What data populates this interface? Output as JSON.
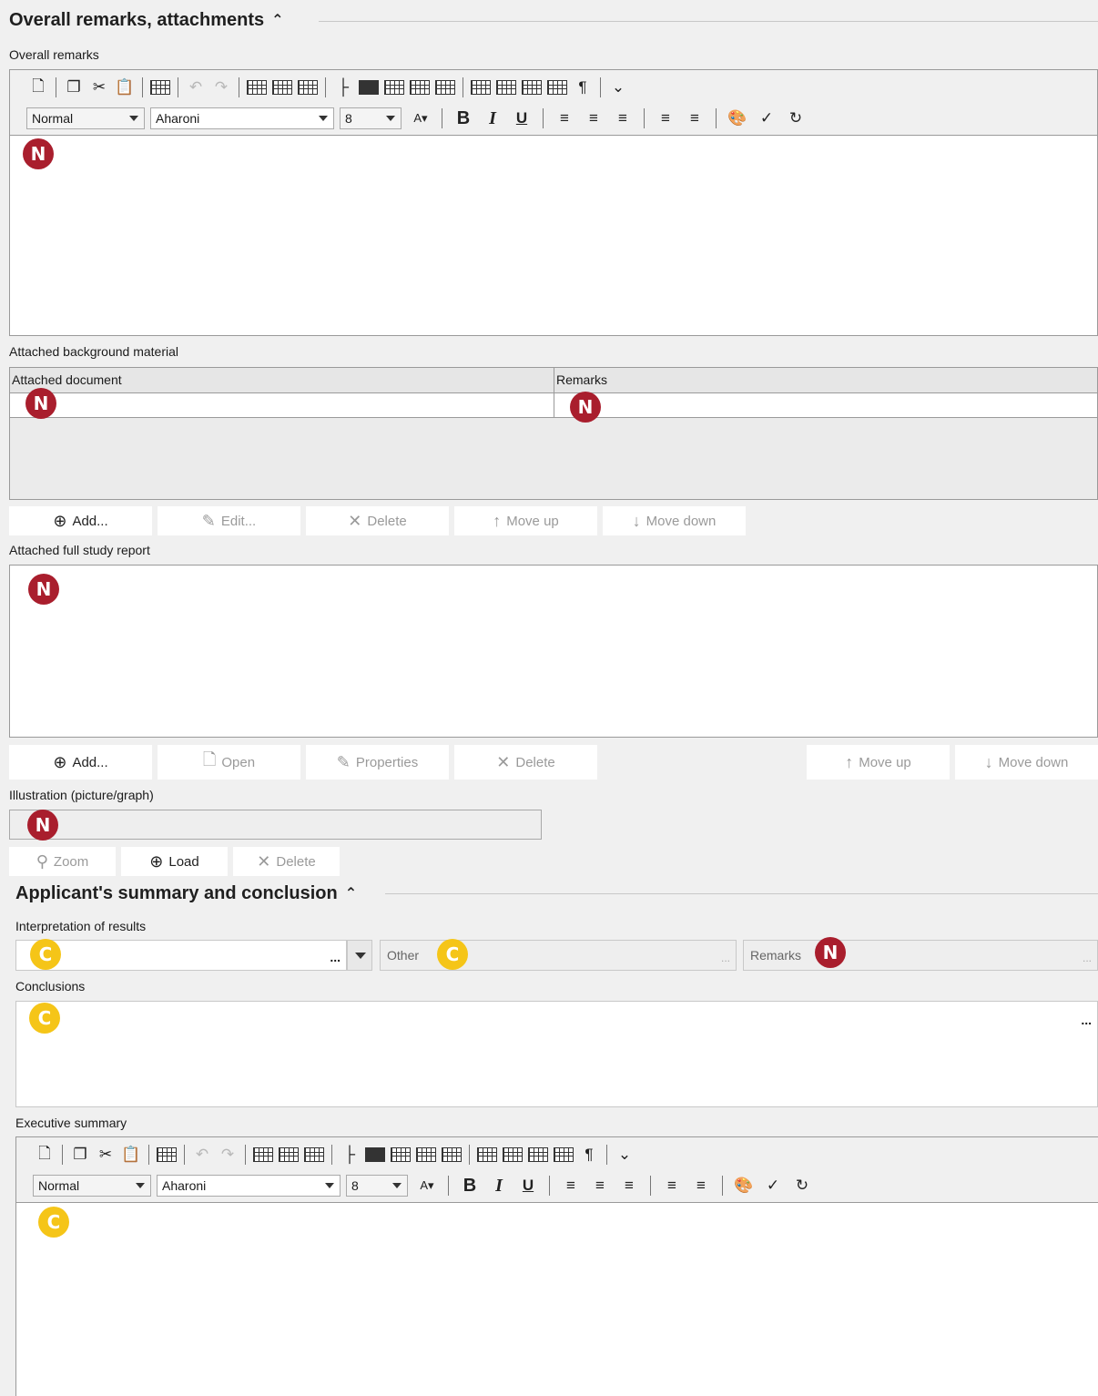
{
  "section1": {
    "title": "Overall remarks, attachments",
    "caret": "^"
  },
  "overall_remarks": {
    "label": "Overall remarks",
    "badge": "N"
  },
  "editor_toolbar": {
    "style_value": "Normal",
    "font_value": "Aharoni",
    "size_value": "8",
    "bold": "B",
    "italic": "I",
    "underline": "U",
    "pilcrow": "¶"
  },
  "background_material": {
    "label": "Attached background material",
    "columns": [
      "Attached document",
      "Remarks"
    ],
    "badges": [
      "N",
      "N"
    ]
  },
  "bg_buttons": {
    "add": "Add...",
    "edit": "Edit...",
    "delete": "Delete",
    "move_up": "Move up",
    "move_down": "Move down"
  },
  "full_study_report": {
    "label": "Attached full study report",
    "badge": "N"
  },
  "fsr_buttons": {
    "add": "Add...",
    "open": "Open",
    "properties": "Properties",
    "delete": "Delete",
    "move_up": "Move up",
    "move_down": "Move down"
  },
  "illustration": {
    "label": "Illustration (picture/graph)",
    "badge": "N"
  },
  "ill_buttons": {
    "zoom": "Zoom",
    "load": "Load",
    "delete": "Delete"
  },
  "section2": {
    "title": "Applicant's summary and conclusion",
    "caret": "^"
  },
  "interpretation": {
    "label": "Interpretation of results",
    "badge": "C",
    "ellipsis": "...",
    "other_label": "Other",
    "other_badge": "C",
    "remarks_label": "Remarks",
    "remarks_badge": "N"
  },
  "conclusions": {
    "label": "Conclusions",
    "badge": "C",
    "ellipsis": "..."
  },
  "executive_summary": {
    "label": "Executive summary",
    "badge": "C"
  }
}
